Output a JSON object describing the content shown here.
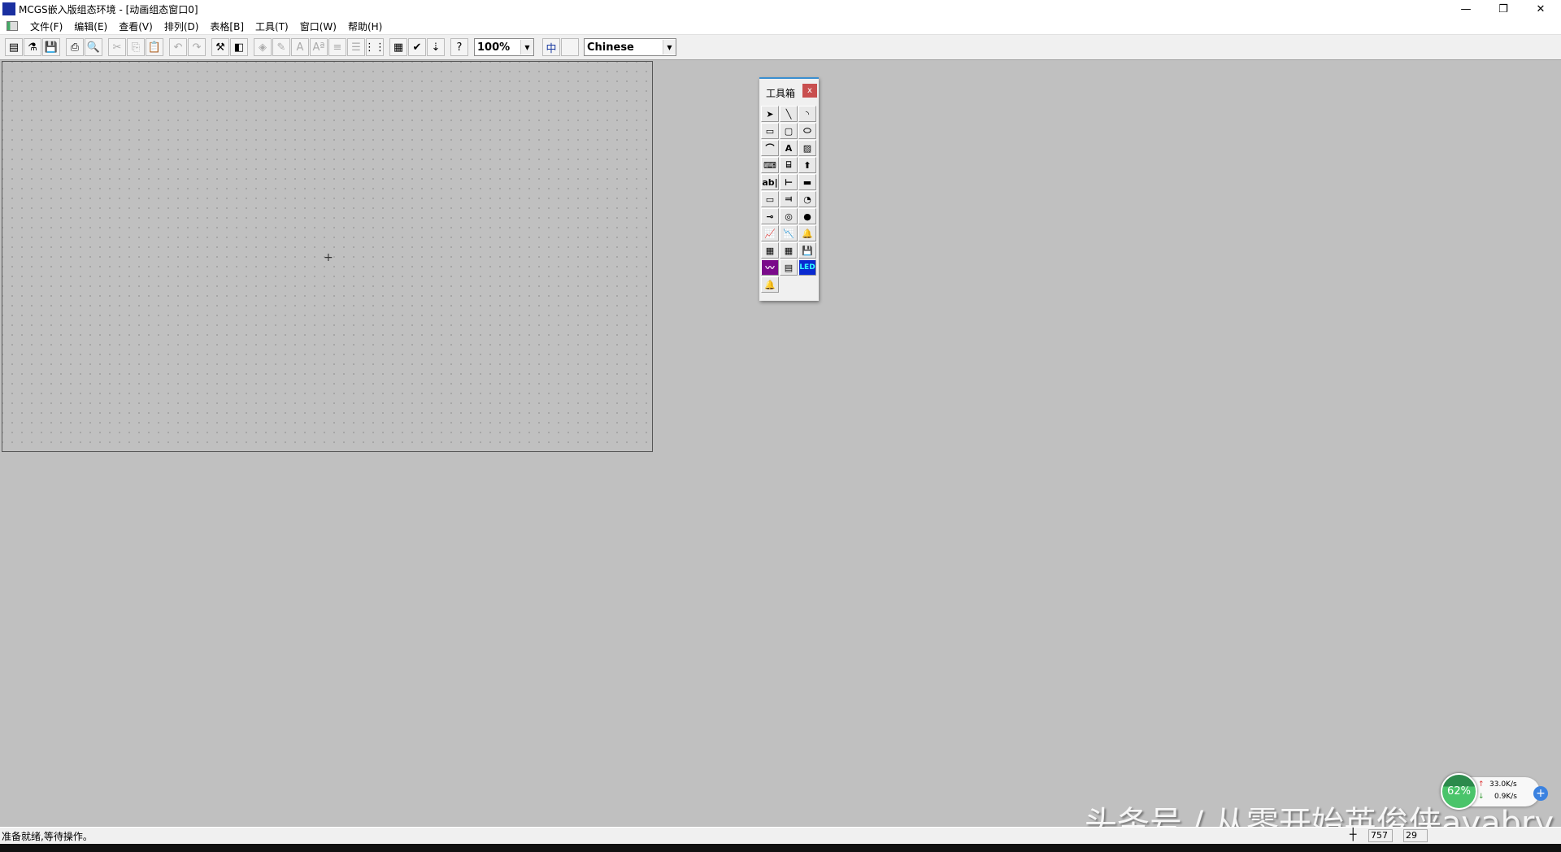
{
  "window": {
    "title": "MCGS嵌入版组态环境 - [动画组态窗口0]",
    "app_icon_text": "MCGS"
  },
  "menus": [
    "文件(F)",
    "编辑(E)",
    "查看(V)",
    "排列(D)",
    "表格[B]",
    "工具(T)",
    "窗口(W)",
    "帮助(H)"
  ],
  "toolbar": {
    "groups": [
      [
        {
          "name": "new-window",
          "glyph": "▤"
        },
        {
          "name": "components",
          "glyph": "⚗"
        },
        {
          "name": "save",
          "glyph": "💾"
        }
      ],
      [
        {
          "name": "print",
          "glyph": "⎙"
        },
        {
          "name": "print-preview",
          "glyph": "🔍"
        }
      ],
      [
        {
          "name": "cut",
          "glyph": "✂",
          "disabled": true
        },
        {
          "name": "copy",
          "glyph": "⎘",
          "disabled": true
        },
        {
          "name": "paste",
          "glyph": "📋",
          "disabled": true
        }
      ],
      [
        {
          "name": "undo",
          "glyph": "↶",
          "disabled": true
        },
        {
          "name": "redo",
          "glyph": "↷",
          "disabled": true
        }
      ],
      [
        {
          "name": "toolbox",
          "glyph": "⚒"
        },
        {
          "name": "properties",
          "glyph": "◧"
        }
      ],
      [
        {
          "name": "fill-color",
          "glyph": "◈",
          "disabled": true
        },
        {
          "name": "line-color",
          "glyph": "✎",
          "disabled": true
        },
        {
          "name": "font",
          "glyph": "A",
          "disabled": true
        },
        {
          "name": "font-size",
          "glyph": "Aª",
          "disabled": true
        },
        {
          "name": "line-style",
          "glyph": "≡",
          "disabled": true
        },
        {
          "name": "align",
          "glyph": "☰",
          "disabled": true
        },
        {
          "name": "grid",
          "glyph": "⋮⋮"
        }
      ],
      [
        {
          "name": "window-properties",
          "glyph": "▦"
        },
        {
          "name": "check",
          "glyph": "✔"
        },
        {
          "name": "sort",
          "glyph": "⇣"
        }
      ],
      [
        {
          "name": "help",
          "glyph": "?"
        }
      ]
    ],
    "zoom": "100%",
    "lang_button_glyph": "中",
    "language": "Chinese"
  },
  "toolbox": {
    "title": "工具箱",
    "close": "x",
    "tools": [
      {
        "name": "pointer",
        "glyph": "➤"
      },
      {
        "name": "line",
        "glyph": "╲"
      },
      {
        "name": "arc",
        "glyph": "◝"
      },
      {
        "name": "rectangle",
        "glyph": "▭"
      },
      {
        "name": "rounded-rectangle",
        "glyph": "▢"
      },
      {
        "name": "ellipse",
        "glyph": "⬭"
      },
      {
        "name": "polyline",
        "glyph": "⌒"
      },
      {
        "name": "label",
        "glyph": "A"
      },
      {
        "name": "bitmap",
        "glyph": "▨"
      },
      {
        "name": "insert-component",
        "glyph": "⌨"
      },
      {
        "name": "common-symbol",
        "glyph": "⌸"
      },
      {
        "name": "element-library",
        "glyph": "⬆"
      },
      {
        "name": "input-box",
        "glyph": "ab|"
      },
      {
        "name": "slider",
        "glyph": "⊢"
      },
      {
        "name": "bar-meter",
        "glyph": "▬"
      },
      {
        "name": "standard-button",
        "glyph": "▭"
      },
      {
        "name": "dynamic-button",
        "glyph": "⫤"
      },
      {
        "name": "rotary-meter",
        "glyph": "◔"
      },
      {
        "name": "slide-input",
        "glyph": "⊸"
      },
      {
        "name": "gauge",
        "glyph": "◎"
      },
      {
        "name": "indicator-light",
        "glyph": "●"
      },
      {
        "name": "realtime-curve",
        "glyph": "📈"
      },
      {
        "name": "history-curve",
        "glyph": "📉"
      },
      {
        "name": "alarm-display",
        "glyph": "🔔"
      },
      {
        "name": "custom-table",
        "glyph": "▦"
      },
      {
        "name": "history-table",
        "glyph": "▦"
      },
      {
        "name": "storage",
        "glyph": "💾"
      },
      {
        "name": "trend-chart",
        "glyph": "〰"
      },
      {
        "name": "report",
        "glyph": "▤"
      },
      {
        "name": "led",
        "glyph": "LED"
      },
      {
        "name": "alarm-browse",
        "glyph": "🔔"
      }
    ]
  },
  "status": {
    "text": "准备就绪,等待操作。",
    "x": "757",
    "y": "29"
  },
  "net_widget": {
    "cpu": "62%",
    "upload": "33.0K/s",
    "download": "0.9K/s",
    "plus": "+"
  },
  "watermark": "头条号 / 从零开始英俊侠ayabry"
}
